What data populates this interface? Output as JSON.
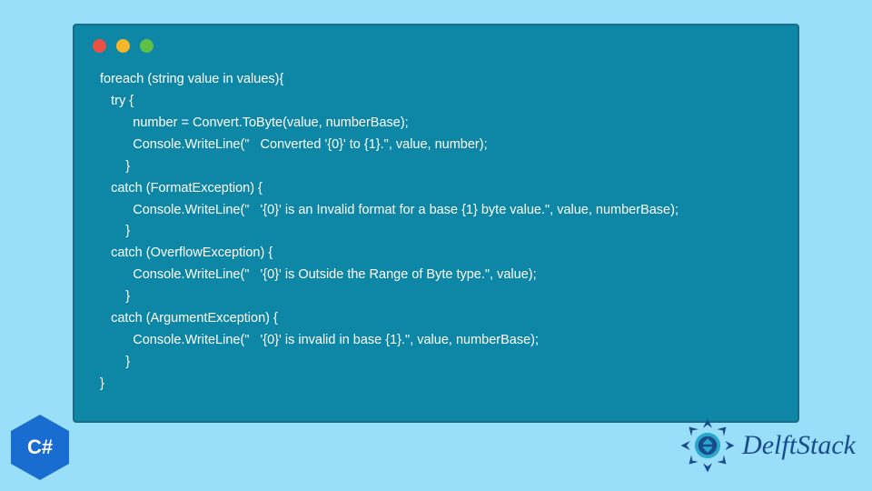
{
  "window": {
    "dots": [
      "red",
      "yellow",
      "green"
    ]
  },
  "code": {
    "lines": [
      "foreach (string value in values){",
      "   try {",
      "         number = Convert.ToByte(value, numberBase);",
      "         Console.WriteLine(\"   Converted '{0}' to {1}.\", value, number);",
      "       }",
      "   catch (FormatException) {",
      "         Console.WriteLine(\"   '{0}' is an Invalid format for a base {1} byte value.\", value, numberBase);",
      "       }",
      "   catch (OverflowException) {",
      "         Console.WriteLine(\"   '{0}' is Outside the Range of Byte type.\", value);",
      "       }",
      "   catch (ArgumentException) {",
      "         Console.WriteLine(\"   '{0}' is invalid in base {1}.\", value, numberBase);",
      "       }",
      "}"
    ]
  },
  "badges": {
    "csharp": "C#",
    "brand": "DelftStack"
  },
  "colors": {
    "page_bg": "#99dff9",
    "window_bg": "#0e86a5",
    "csharp_hex": "#1a6dd0",
    "brand_text": "#1a4b8c"
  }
}
